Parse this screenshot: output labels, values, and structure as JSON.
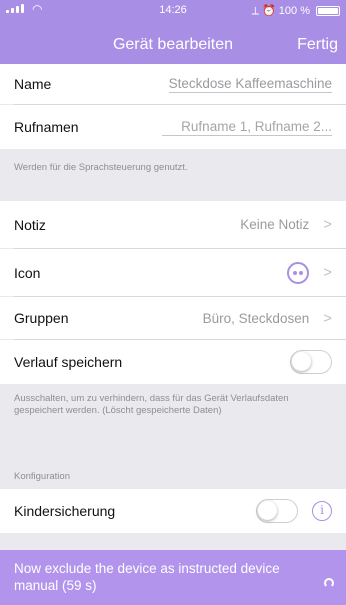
{
  "status": {
    "time": "14:26",
    "battery": "100 %",
    "right_icons": "⟂ ⏰"
  },
  "nav": {
    "title": "Gerät bearbeiten",
    "done": "Fertig"
  },
  "fields": {
    "name_label": "Name",
    "name_value": "Steckdose Kaffeemaschine",
    "callname_label": "Rufnamen",
    "callname_placeholder": "Rufname 1, Rufname 2...",
    "callname_note": "Werden für die Sprachsteuerung genutzt."
  },
  "rows": {
    "note_label": "Notiz",
    "note_value": "Keine Notiz",
    "icon_label": "Icon",
    "icon_name": "dots-face-icon",
    "groups_label": "Gruppen",
    "groups_value": "Büro, Steckdosen",
    "history_label": "Verlauf speichern",
    "history_on": false,
    "history_note": "Ausschalten, um zu verhindern, dass für das Gerät Verlaufsdaten gespeichert werden. (Löscht gespeicherte Daten)"
  },
  "config": {
    "header": "Konfiguration",
    "childlock_label": "Kindersicherung",
    "childlock_on": false
  },
  "banner": {
    "text": "Now exclude the device as instructed device manual (59 s)"
  },
  "colors": {
    "accent": "#a98ee6",
    "banner": "#b294ec",
    "background": "#e9e9ee"
  }
}
